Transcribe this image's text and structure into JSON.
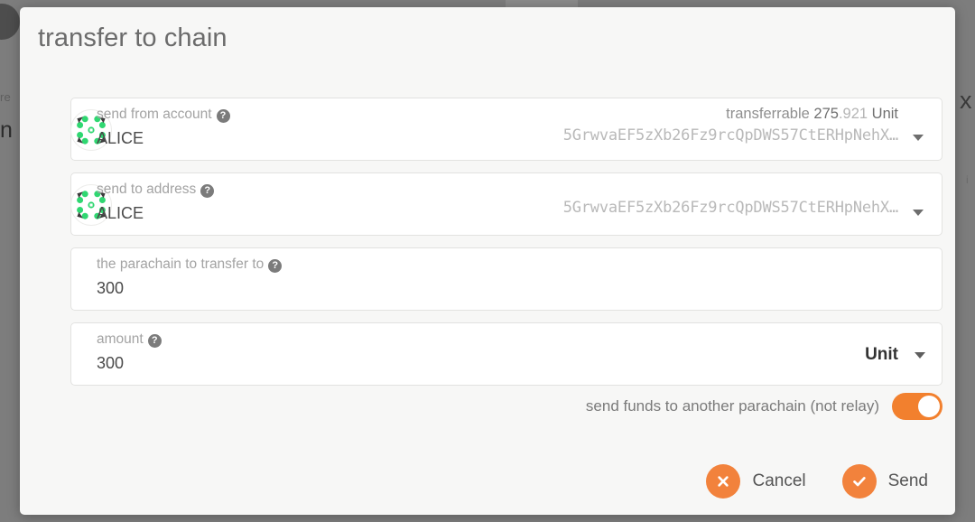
{
  "background": {
    "fragment_small": "re",
    "fragment_large": "n",
    "right_fragment_large": "x",
    "right_fragment_small": "i"
  },
  "modal": {
    "title": "transfer to chain",
    "fields": [
      {
        "key": "send_from_account",
        "label": "send from account",
        "help_icon": "question-mark-icon",
        "value": "ALICE",
        "avatar_icon": "polkadot-identicon",
        "transferrable_prefix": "transferrable",
        "transferrable_int": "275",
        "transferrable_dec": ".921",
        "transferrable_unit": "Unit",
        "address": "5GrwvaEF5zXb26Fz9rcQpDWS57CtERHpNehX…",
        "caret_icon": "chevron-down-icon"
      },
      {
        "key": "send_to_address",
        "label": "send to address",
        "help_icon": "question-mark-icon",
        "value": "ALICE",
        "avatar_icon": "polkadot-identicon",
        "address": "5GrwvaEF5zXb26Fz9rcQpDWS57CtERHpNehX…",
        "caret_icon": "chevron-down-icon"
      },
      {
        "key": "parachain",
        "label": "the parachain to transfer to",
        "help_icon": "question-mark-icon",
        "value": "300"
      },
      {
        "key": "amount",
        "label": "amount",
        "help_icon": "question-mark-icon",
        "value": "300",
        "unit_selected": "Unit",
        "caret_icon": "chevron-down-icon"
      }
    ],
    "toggle": {
      "label": "send funds to another parachain (not relay)",
      "state": "on"
    },
    "buttons": {
      "cancel_label": "Cancel",
      "cancel_icon": "x-circle-icon",
      "send_label": "Send",
      "send_icon": "check-circle-icon"
    }
  },
  "colors": {
    "accent": "#f2823c",
    "toggle_on": "#f2802e",
    "identicon_green": "#2fd771",
    "modal_bg": "#f7f7f6",
    "overlay": "#808080"
  }
}
